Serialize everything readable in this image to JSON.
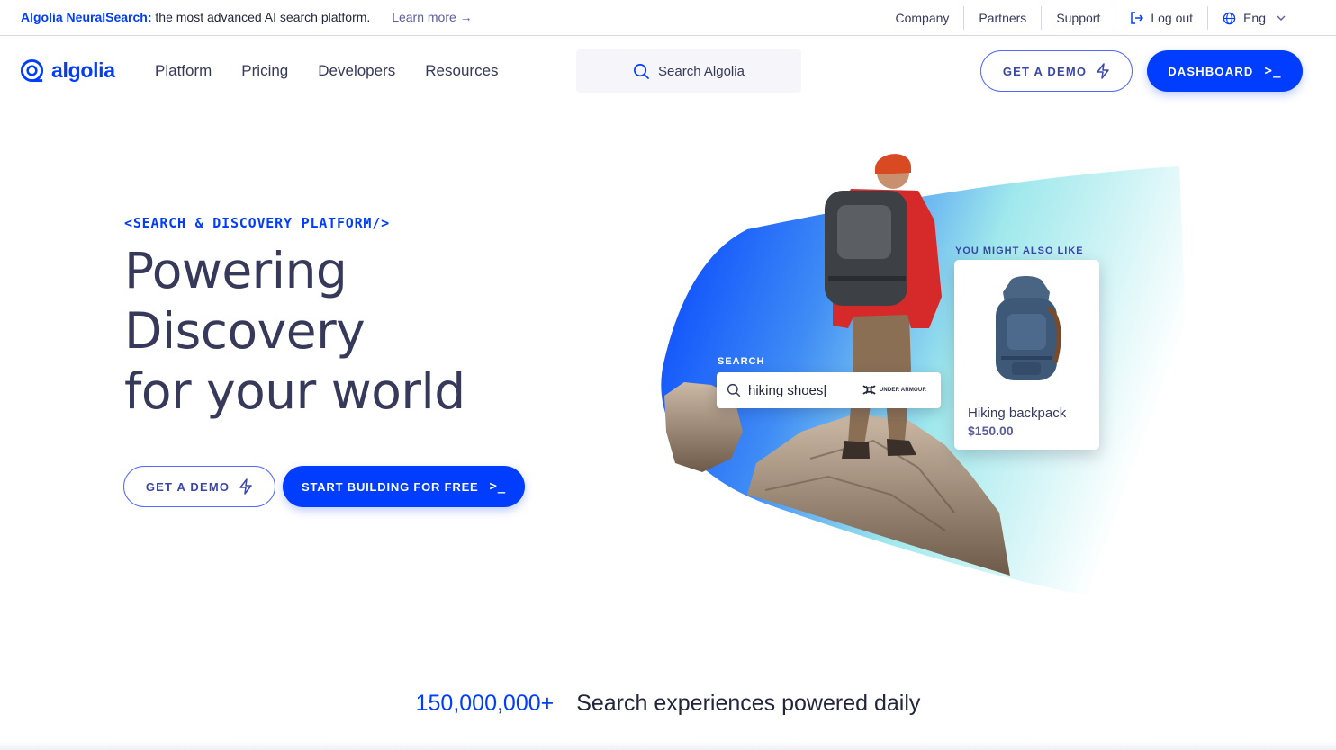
{
  "announcement": {
    "brand": "Algolia NeuralSearch:",
    "tagline": "the most advanced AI search platform.",
    "learn_more": "Learn more →"
  },
  "utility_nav": {
    "company": "Company",
    "partners": "Partners",
    "support": "Support",
    "logout": "Log out",
    "language": "Eng"
  },
  "header": {
    "logo_text": "algolia",
    "menu": [
      "Platform",
      "Pricing",
      "Developers",
      "Resources"
    ],
    "search_placeholder": "Search Algolia",
    "get_demo": "GET A DEMO",
    "dashboard": "DASHBOARD",
    "terminal_glyph": ">_"
  },
  "hero": {
    "eyebrow": "<SEARCH & DISCOVERY PLATFORM/>",
    "headline": [
      "Powering",
      "Discovery",
      "for your world"
    ],
    "cta_demo": "GET A DEMO",
    "cta_start": "START BUILDING FOR FREE",
    "terminal_glyph": ">_"
  },
  "visual": {
    "search_label": "SEARCH",
    "search_query": "hiking shoes|",
    "brand_badge": "UNDER ARMOUR",
    "reco_label": "YOU MIGHT ALSO LIKE",
    "product_name": "Hiking backpack",
    "product_price": "$150.00"
  },
  "stats": {
    "number": "150,000,000+",
    "text": "Search experiences powered daily"
  },
  "colors": {
    "brand_blue": "#003dff",
    "text_dark": "#23263b",
    "text_muted": "#36395a",
    "outline": "#5468ff"
  }
}
